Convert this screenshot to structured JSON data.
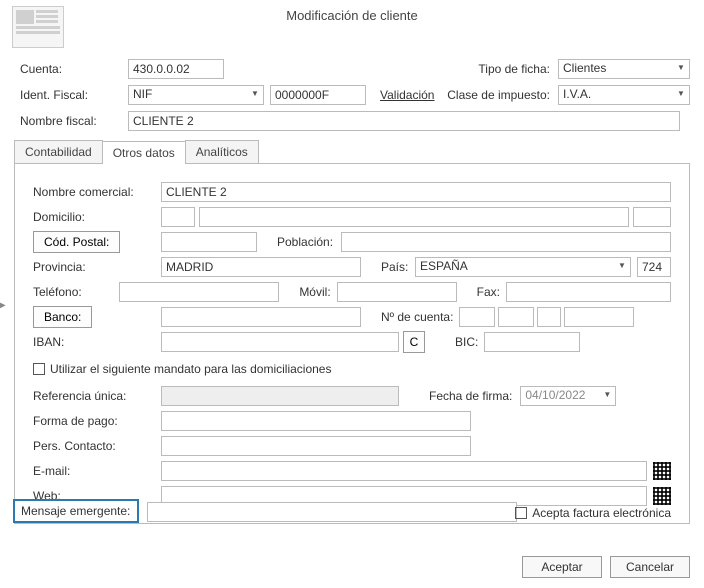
{
  "title": "Modificación de cliente",
  "top": {
    "cuenta_lbl": "Cuenta:",
    "cuenta_val": "430.0.0.02",
    "tipo_ficha_lbl": "Tipo de ficha:",
    "tipo_ficha_val": "Clientes",
    "ident_fiscal_lbl": "Ident. Fiscal:",
    "ident_tipo": "NIF",
    "ident_val": "0000000F",
    "validacion": "Validación",
    "clase_imp_lbl": "Clase de impuesto:",
    "clase_imp_val": "I.V.A.",
    "nombre_fiscal_lbl": "Nombre fiscal:",
    "nombre_fiscal_val": "CLIENTE 2"
  },
  "tabs": {
    "t0": "Contabilidad",
    "t1": "Otros datos",
    "t2": "Analíticos"
  },
  "panel": {
    "nombre_com_lbl": "Nombre comercial:",
    "nombre_com_val": "CLIENTE 2",
    "domicilio_lbl": "Domicilio:",
    "cod_postal_btn": "Cód. Postal:",
    "poblacion_lbl": "Población:",
    "provincia_lbl": "Provincia:",
    "provincia_val": "MADRID",
    "pais_lbl": "País:",
    "pais_val": "ESPAÑA",
    "pais_code": "724",
    "telefono_lbl": "Teléfono:",
    "movil_lbl": "Móvil:",
    "fax_lbl": "Fax:",
    "banco_btn": "Banco:",
    "ncuenta_lbl": "Nº de cuenta:",
    "iban_lbl": "IBAN:",
    "c_btn": "C",
    "bic_lbl": "BIC:",
    "mandato_chk": "Utilizar el siguiente mandato para las domiciliaciones",
    "ref_unica_lbl": "Referencia única:",
    "fecha_firma_lbl": "Fecha de firma:",
    "fecha_firma_val": "04/10/2022",
    "forma_pago_lbl": "Forma de pago:",
    "pers_contacto_lbl": "Pers. Contacto:",
    "email_lbl": "E-mail:",
    "web_lbl": "Web:",
    "mensaje_lbl": "Mensaje emergente:",
    "acepta_fact_lbl": "Acepta factura electrónica"
  },
  "footer": {
    "aceptar": "Aceptar",
    "cancelar": "Cancelar"
  }
}
